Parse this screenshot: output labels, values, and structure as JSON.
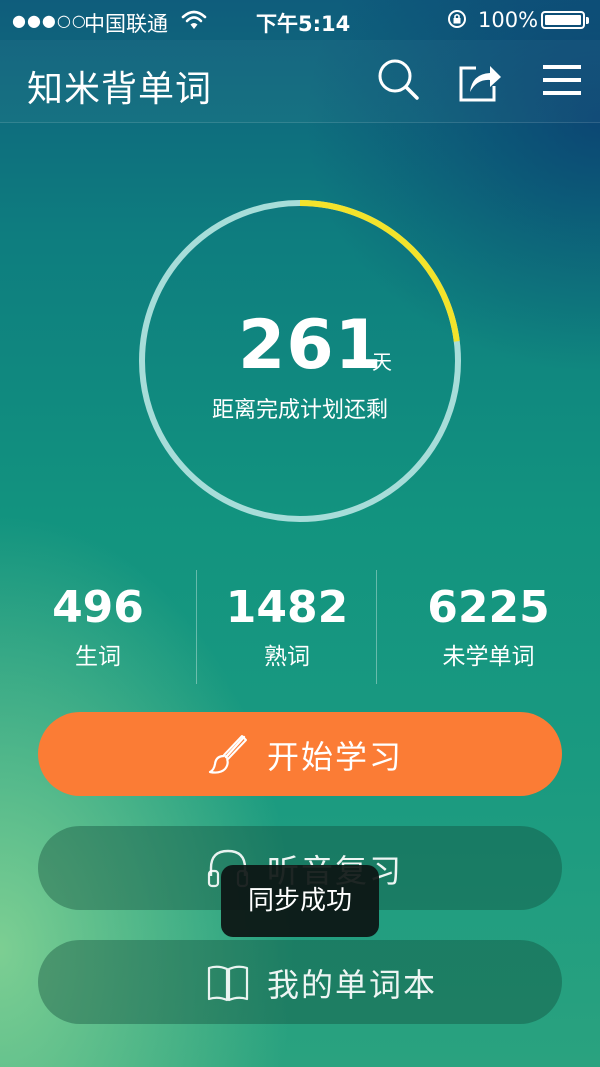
{
  "status_bar": {
    "signal": "●●●○○",
    "carrier": "中国联通",
    "time": "下午5:14",
    "battery": "100%"
  },
  "header": {
    "title": "知米背单词",
    "icons": [
      "search-icon",
      "share-icon",
      "menu-icon"
    ]
  },
  "plan": {
    "days_remaining": "261",
    "unit": "天",
    "caption": "距离完成计划还剩",
    "progress_fraction": 0.23,
    "ring_color": "#a7ddd9",
    "progress_color": "#f3e32b"
  },
  "stats": [
    {
      "value": "496",
      "label": "生词"
    },
    {
      "value": "1482",
      "label": "熟词"
    },
    {
      "value": "6225",
      "label": "未学单词"
    }
  ],
  "actions": {
    "start": {
      "label": "开始学习",
      "icon": "brush-icon",
      "color": "#fb7c35"
    },
    "review": {
      "label": "听音复习",
      "icon": "headphones-icon"
    },
    "wordbook": {
      "label": "我的单词本",
      "icon": "book-icon"
    }
  },
  "toast": {
    "text": "同步成功"
  }
}
